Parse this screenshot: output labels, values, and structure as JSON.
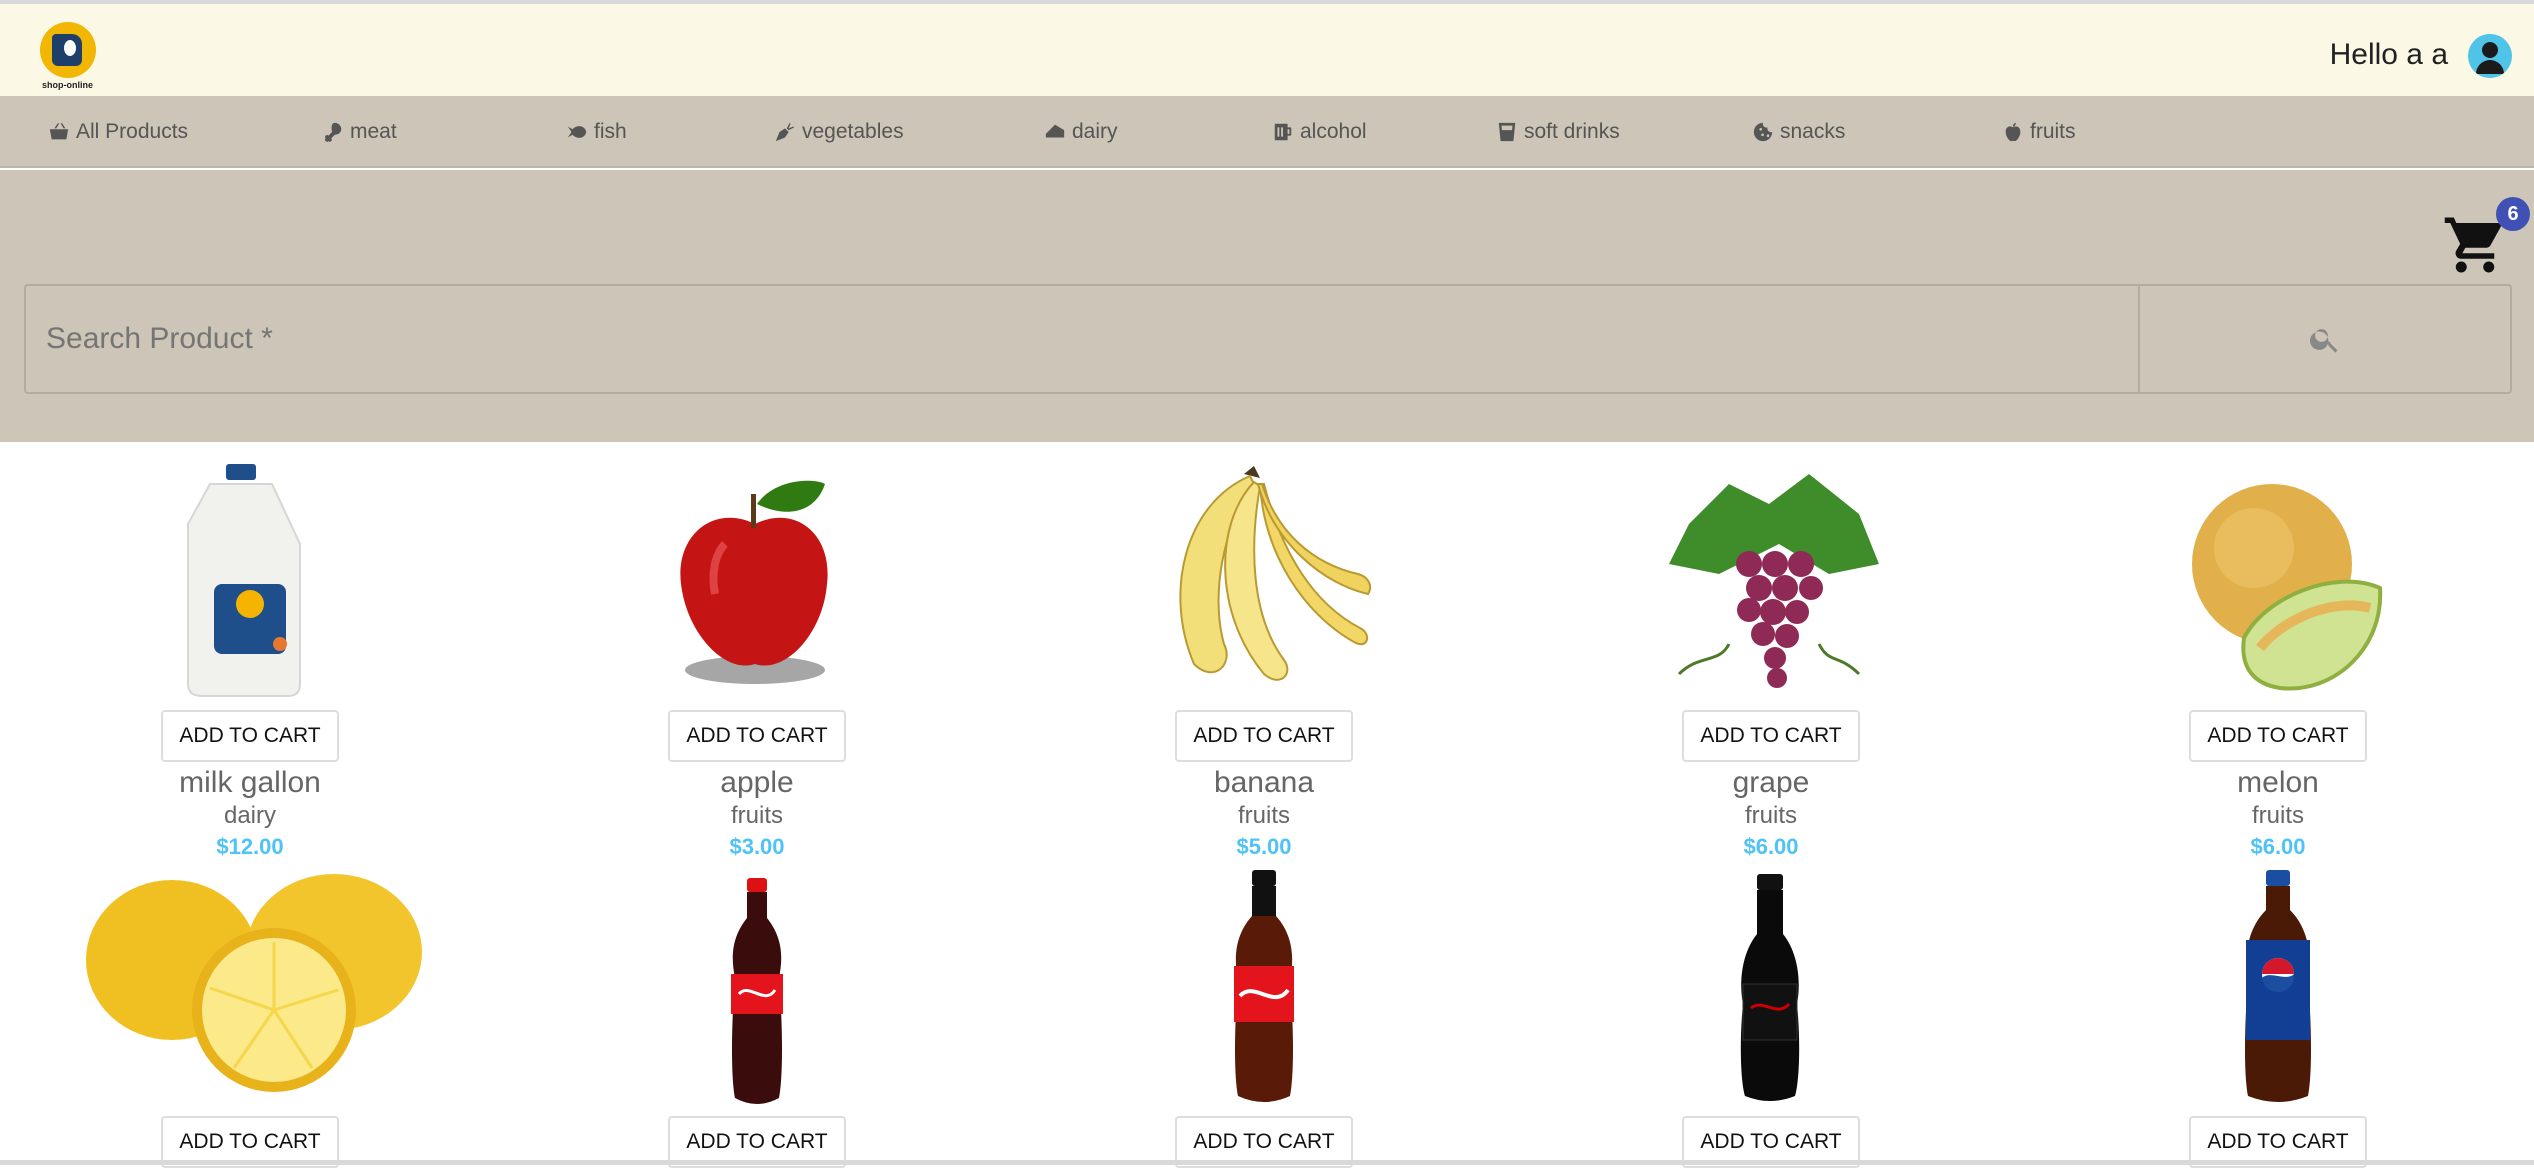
{
  "header": {
    "logo_text": "shop-online",
    "greeting": "Hello a a"
  },
  "nav": {
    "items": [
      {
        "label": "All Products",
        "icon": "basket-icon"
      },
      {
        "label": "meat",
        "icon": "drumstick-icon"
      },
      {
        "label": "fish",
        "icon": "fish-icon"
      },
      {
        "label": "vegetables",
        "icon": "carrot-icon"
      },
      {
        "label": "dairy",
        "icon": "cheese-icon"
      },
      {
        "label": "alcohol",
        "icon": "beer-icon"
      },
      {
        "label": "soft drinks",
        "icon": "glass-icon"
      },
      {
        "label": "snacks",
        "icon": "cookie-icon"
      },
      {
        "label": "fruits",
        "icon": "apple-icon"
      }
    ]
  },
  "cart": {
    "count": "6",
    "icon": "shopping-cart-icon"
  },
  "search": {
    "placeholder": "Search Product *",
    "icon": "search-icon"
  },
  "products": {
    "add_label": "ADD TO CART",
    "items": [
      {
        "name": "milk gallon",
        "category": "dairy",
        "price": "$12.00"
      },
      {
        "name": "apple",
        "category": "fruits",
        "price": "$3.00"
      },
      {
        "name": "banana",
        "category": "fruits",
        "price": "$5.00"
      },
      {
        "name": "grape",
        "category": "fruits",
        "price": "$6.00"
      },
      {
        "name": "melon",
        "category": "fruits",
        "price": "$6.00"
      },
      {
        "name": "",
        "category": "",
        "price": ""
      },
      {
        "name": "",
        "category": "",
        "price": ""
      },
      {
        "name": "",
        "category": "",
        "price": ""
      },
      {
        "name": "",
        "category": "",
        "price": ""
      },
      {
        "name": "",
        "category": "",
        "price": ""
      }
    ]
  },
  "colors": {
    "header_bg": "#fcf8e6",
    "nav_bg": "#cdc6b8",
    "price": "#4fc3f7",
    "badge": "#3f51b5",
    "avatar": "#4fc3e8"
  }
}
